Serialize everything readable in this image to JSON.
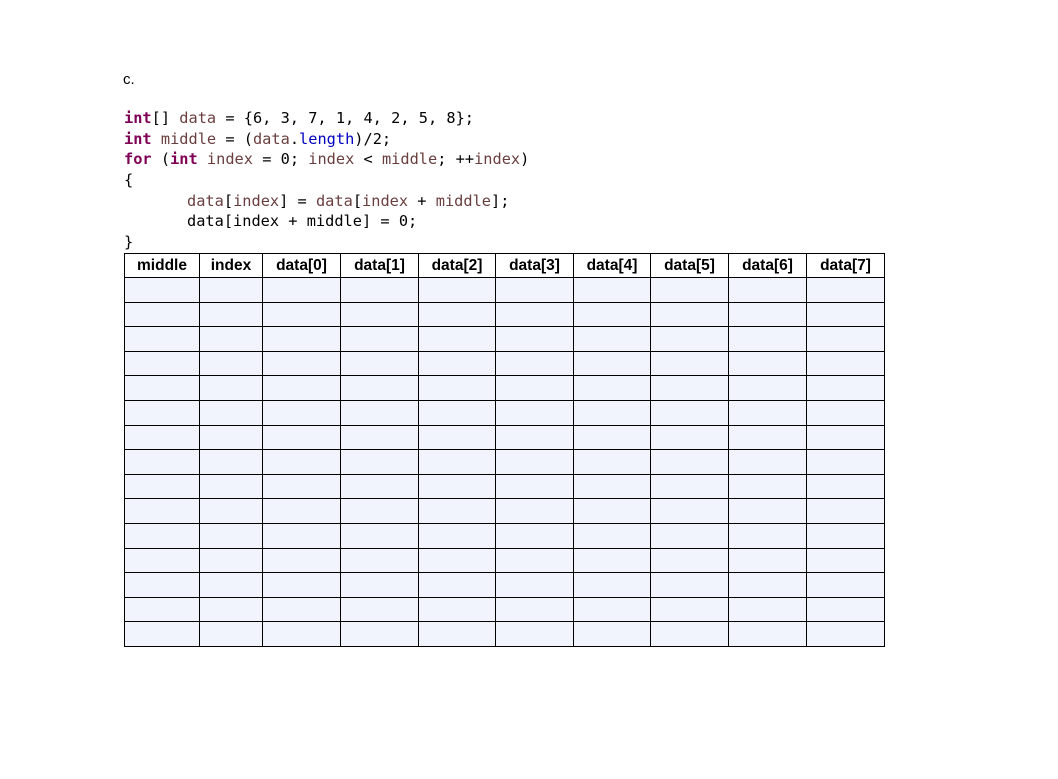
{
  "label": "c.",
  "code": {
    "line1": [
      {
        "t": "int",
        "c": "kw"
      },
      {
        "t": "[] ",
        "c": ""
      },
      {
        "t": "data",
        "c": "var"
      },
      {
        "t": " = {6, 3, 7, 1, 4, 2, 5, 8};",
        "c": ""
      }
    ],
    "line2": [
      {
        "t": "int",
        "c": "kw"
      },
      {
        "t": " ",
        "c": ""
      },
      {
        "t": "middle",
        "c": "var"
      },
      {
        "t": " = (",
        "c": ""
      },
      {
        "t": "data",
        "c": "var"
      },
      {
        "t": ".",
        "c": ""
      },
      {
        "t": "length",
        "c": "fld"
      },
      {
        "t": ")/2;",
        "c": ""
      }
    ],
    "line3": [
      {
        "t": "for",
        "c": "kw"
      },
      {
        "t": " (",
        "c": ""
      },
      {
        "t": "int",
        "c": "kw"
      },
      {
        "t": " ",
        "c": ""
      },
      {
        "t": "index",
        "c": "var"
      },
      {
        "t": " = 0; ",
        "c": ""
      },
      {
        "t": "index",
        "c": "var"
      },
      {
        "t": " < ",
        "c": ""
      },
      {
        "t": "middle",
        "c": "var"
      },
      {
        "t": "; ++",
        "c": ""
      },
      {
        "t": "index",
        "c": "var"
      },
      {
        "t": ")",
        "c": ""
      }
    ],
    "line4": [
      {
        "t": "{",
        "c": ""
      }
    ],
    "line5": [
      {
        "t": "data",
        "c": "var"
      },
      {
        "t": "[",
        "c": ""
      },
      {
        "t": "index",
        "c": "var"
      },
      {
        "t": "] = ",
        "c": ""
      },
      {
        "t": "data",
        "c": "var"
      },
      {
        "t": "[",
        "c": ""
      },
      {
        "t": "index",
        "c": "var"
      },
      {
        "t": " + ",
        "c": ""
      },
      {
        "t": "middle",
        "c": "var"
      },
      {
        "t": "];",
        "c": ""
      }
    ],
    "line6": [
      {
        "t": "data[index + middle] = 0;",
        "c": ""
      }
    ],
    "line7": [
      {
        "t": "}",
        "c": ""
      }
    ]
  },
  "table": {
    "headers": [
      "middle",
      "index",
      "data[0]",
      "data[1]",
      "data[2]",
      "data[3]",
      "data[4]",
      "data[5]",
      "data[6]",
      "data[7]"
    ],
    "empty_rows": 15
  }
}
